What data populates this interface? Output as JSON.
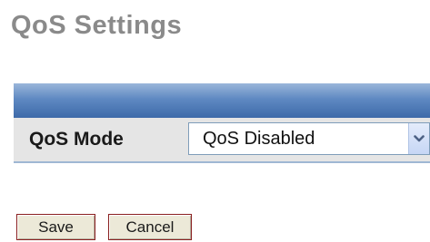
{
  "page": {
    "title": "QoS Settings"
  },
  "qos": {
    "label": "QoS Mode",
    "selected": "QoS Disabled"
  },
  "actions": {
    "save_label": "Save",
    "cancel_label": "Cancel"
  },
  "colors": {
    "title_gray": "#8a8a8a",
    "header_blue": "#5f89c2",
    "row_bg": "#e5e5e5",
    "button_border": "#8a2020"
  },
  "icons": {
    "select_arrow": "chevron-down-icon"
  }
}
